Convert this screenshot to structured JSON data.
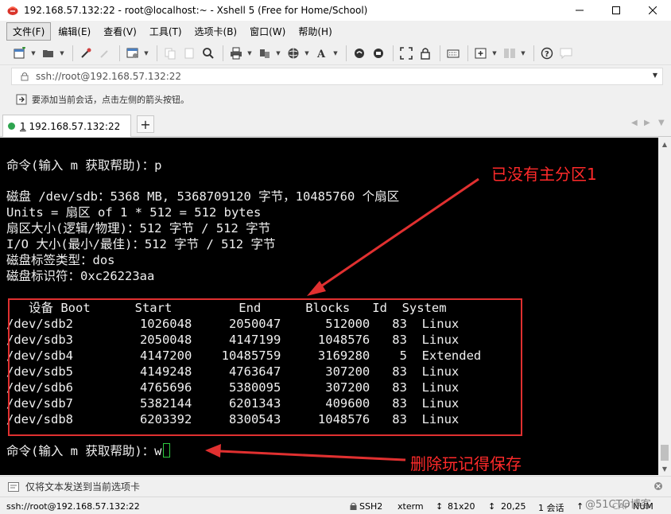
{
  "window": {
    "title": "192.168.57.132:22 - root@localhost:~ - Xshell 5 (Free for Home/School)"
  },
  "menu": [
    "文件(F)",
    "编辑(E)",
    "查看(V)",
    "工具(T)",
    "选项卡(B)",
    "窗口(W)",
    "帮助(H)"
  ],
  "address": {
    "value": "ssh://root@192.168.57.132:22"
  },
  "hint": {
    "text": "要添加当前会话，点击左侧的箭头按钮。"
  },
  "tab": {
    "index": "1",
    "label": "192.168.57.132:22"
  },
  "terminal": {
    "lines": [
      "命令(输入 m 获取帮助)：p",
      "",
      "磁盘 /dev/sdb：5368 MB, 5368709120 字节，10485760 个扇区",
      "Units = 扇区 of 1 * 512 = 512 bytes",
      "扇区大小(逻辑/物理)：512 字节 / 512 字节",
      "I/O 大小(最小/最佳)：512 字节 / 512 字节",
      "磁盘标签类型：dos",
      "磁盘标识符：0xc26223aa",
      "",
      "   设备 Boot      Start         End      Blocks   Id  System",
      "/dev/sdb2         1026048     2050047      512000   83  Linux",
      "/dev/sdb3         2050048     4147199     1048576   83  Linux",
      "/dev/sdb4         4147200    10485759     3169280    5  Extended",
      "/dev/sdb5         4149248     4763647      307200   83  Linux",
      "/dev/sdb6         4765696     5380095      307200   83  Linux",
      "/dev/sdb7         5382144     6201343      409600   83  Linux",
      "/dev/sdb8         6203392     8300543     1048576   83  Linux",
      "",
      "命令(输入 m 获取帮助)：w"
    ],
    "annotation_top": "已没有主分区1",
    "annotation_bottom": "删除玩记得保存",
    "accent": "#e03030"
  },
  "compose": {
    "placeholder": "仅将文本发送到当前选项卡"
  },
  "status": {
    "connection": "ssh://root@192.168.57.132:22",
    "protocol": "SSH2",
    "term": "xterm",
    "size": "81x20",
    "cursor_pos": "20,25",
    "sessions": "1 会话",
    "caps": "CAP",
    "num": "NUM",
    "watermark": "@51CTO博客"
  }
}
